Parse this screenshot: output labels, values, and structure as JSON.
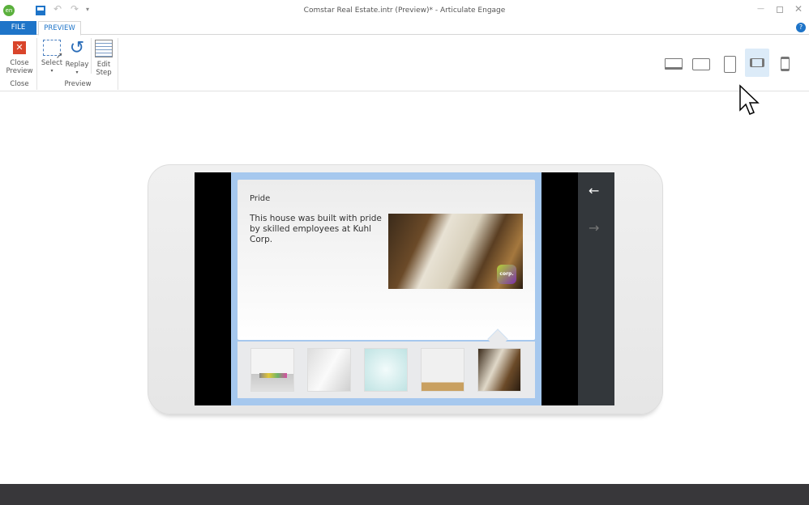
{
  "window": {
    "title": "Comstar Real Estate.intr (Preview)* -  Articulate Engage",
    "app_badge": "en"
  },
  "tabs": [
    {
      "label": "FILE"
    },
    {
      "label": "PREVIEW"
    }
  ],
  "ribbon": {
    "close_preview": "Close\nPreview",
    "close_group": "Close",
    "select": "Select",
    "replay": "Replay",
    "preview_group": "Preview",
    "edit_step": "Edit\nStep"
  },
  "devices": [
    "laptop",
    "tablet-landscape",
    "tablet-portrait",
    "phone-landscape",
    "phone-portrait"
  ],
  "selected_device": "phone-landscape",
  "slide": {
    "title": "Pride",
    "body": "This house was built with pride by skilled employees at Kuhl Corp.",
    "logo": "Kuhl Corp."
  },
  "colors": {
    "accent": "#1e74c8",
    "frame_border": "#a6c8ee",
    "nav_bg": "#33373b"
  }
}
